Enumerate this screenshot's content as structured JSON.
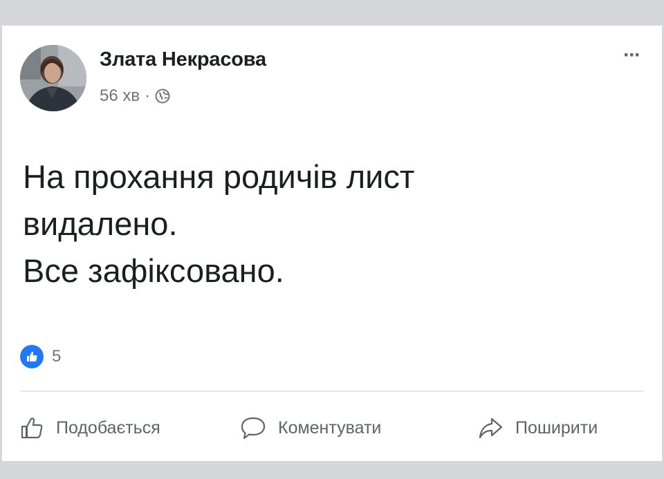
{
  "post": {
    "author": "Злата Некрасова",
    "time": "56 хв",
    "separator": "·",
    "privacy_icon": "globe-icon",
    "more_label": "···",
    "text_lines": [
      "На прохання родичів лист",
      "видалено.",
      "Все зафіксовано."
    ],
    "reaction_icon": "like-icon",
    "reaction_count": "5"
  },
  "actions": {
    "like": "Подобається",
    "comment": "Коментувати",
    "share": "Поширити"
  },
  "colors": {
    "background": "#d4d6da",
    "card": "#ffffff",
    "accent": "#2078f4",
    "text": "#1c1e21",
    "muted": "#707379"
  }
}
